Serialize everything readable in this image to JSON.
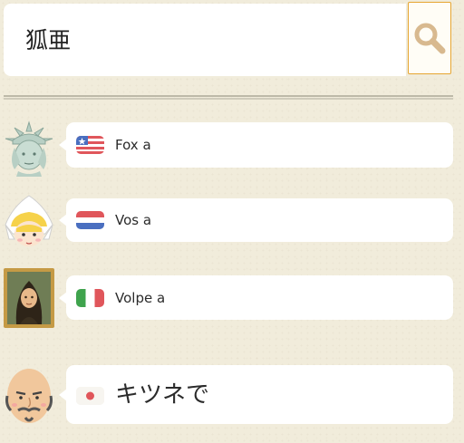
{
  "search": {
    "value": "狐亜",
    "button_icon": "magnifier-icon",
    "accent_color": "#e6a531"
  },
  "translations": [
    {
      "avatar": "statue-of-liberty",
      "language": "English",
      "flag": "flag-usa",
      "text": "Fox a"
    },
    {
      "avatar": "dutch-girl",
      "language": "Dutch",
      "flag": "flag-netherlands",
      "text": "Vos a"
    },
    {
      "avatar": "mona-lisa-portrait",
      "language": "Italian",
      "flag": "flag-italy",
      "text": "Volpe a"
    },
    {
      "avatar": "samurai-man",
      "language": "Japanese",
      "flag": "flag-japan",
      "text": "キツネで"
    }
  ]
}
